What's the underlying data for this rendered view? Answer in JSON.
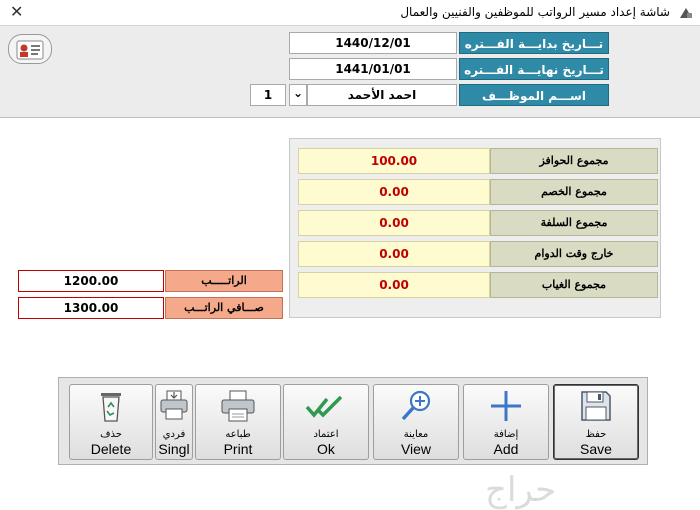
{
  "window": {
    "title": "شاشة إعداد مسير الرواتب للموظفين والفنيين والعمال",
    "close_glyph": "✕"
  },
  "header": {
    "period_start_label": "تـــاريخ بدايـــة الفـــتره",
    "period_start_value": "1440/12/01",
    "period_end_label": "تـــاريخ نهايـــة الفـــتره",
    "period_end_value": "1441/01/01",
    "employee_label": "اســـم الموظـــف",
    "employee_name": "احمد الأحمد",
    "employee_number": "1",
    "dropdown_glyph": "⌄"
  },
  "summary": {
    "items": [
      {
        "label": "مجموع الحوافز",
        "value": "100.00"
      },
      {
        "label": "مجموع الخصم",
        "value": "0.00"
      },
      {
        "label": "مجموع السلفة",
        "value": "0.00"
      },
      {
        "label": "خارج وقت الدوام",
        "value": "0.00"
      },
      {
        "label": "مجموع الغياب",
        "value": "0.00"
      }
    ]
  },
  "salary": {
    "salary_label": "الراتـــــب",
    "salary_value": "1200.00",
    "net_label": "صـــافي الراتـــب",
    "net_value": "1300.00"
  },
  "toolbar": {
    "delete": {
      "ar": "حذف",
      "en": "Delete"
    },
    "single": {
      "ar": "فردي",
      "en": "Singl"
    },
    "print": {
      "ar": "طباعه",
      "en": "Print"
    },
    "ok": {
      "ar": "اعتماد",
      "en": "Ok"
    },
    "view": {
      "ar": "معاينة",
      "en": "View"
    },
    "add": {
      "ar": "إضافة",
      "en": "Add"
    },
    "save": {
      "ar": "حفظ",
      "en": "Save"
    }
  },
  "watermark": {
    "text": "حراج"
  },
  "colors": {
    "teal_label": "#2e8aa7",
    "salary_label": "#f3a98a",
    "summary_value_bg": "#fffbd0",
    "summary_value_text": "#c00000",
    "summary_label_bg": "#d9dbc3"
  }
}
